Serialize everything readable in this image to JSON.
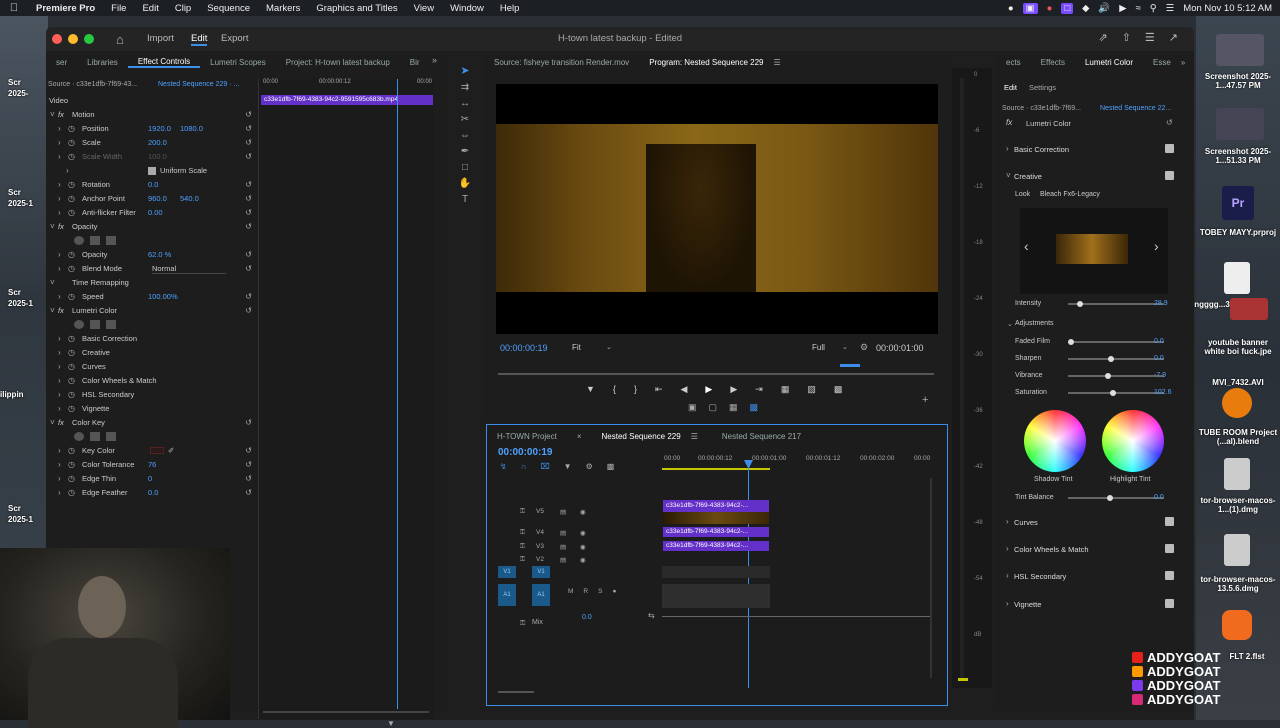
{
  "menubar": {
    "app": "Premiere Pro",
    "items": [
      "File",
      "Edit",
      "Clip",
      "Sequence",
      "Markers",
      "Graphics and Titles",
      "View",
      "Window",
      "Help"
    ],
    "clock": "Mon Nov 10  5:12 AM"
  },
  "window": {
    "title": "H-town latest backup",
    "edited": "- Edited",
    "workspaces": [
      "Import",
      "Edit",
      "Export"
    ],
    "active_workspace": "Edit"
  },
  "left_panel": {
    "tabs": [
      "ser",
      "Libraries",
      "Effect Controls",
      "Lumetri Scopes",
      "Project: H-town latest backup",
      "Bir"
    ],
    "source": "Source · c33e1dfb-7f69-43...",
    "sequence": "Nested Sequence 229 · ...",
    "timecodes": [
      "00:00",
      "00:00:00:12",
      "00:00"
    ],
    "clip_name": "c33e1dfb-7f69-4383-94c2-9591595c683b.mp4",
    "video_label": "Video",
    "rows": [
      {
        "label": "Motion",
        "indent": 1,
        "fx": true
      },
      {
        "label": "Position",
        "indent": 2,
        "v1": "1920.0",
        "v2": "1080.0"
      },
      {
        "label": "Scale",
        "indent": 2,
        "v1": "200.0"
      },
      {
        "label": "Scale Width",
        "indent": 2,
        "v1": "100.0",
        "dim": true
      },
      {
        "label": "Uniform Scale",
        "indent": 3,
        "check": true
      },
      {
        "label": "Rotation",
        "indent": 2,
        "v1": "0.0"
      },
      {
        "label": "Anchor Point",
        "indent": 2,
        "v1": "960.0",
        "v2": "540.0"
      },
      {
        "label": "Anti-flicker Filter",
        "indent": 2,
        "v1": "0.00"
      },
      {
        "label": "Opacity",
        "indent": 1,
        "fx": true
      },
      {
        "label": "",
        "indent": 2,
        "masks": true
      },
      {
        "label": "Opacity",
        "indent": 2,
        "v1": "62.0 %"
      },
      {
        "label": "Blend Mode",
        "indent": 2,
        "dropdown": "Normal"
      },
      {
        "label": "Time Remapping",
        "indent": 1
      },
      {
        "label": "Speed",
        "indent": 2,
        "v1": "100.00%"
      },
      {
        "label": "Lumetri Color",
        "indent": 1,
        "fx": true
      },
      {
        "label": "",
        "indent": 2,
        "masks": true
      },
      {
        "label": "Basic Correction",
        "indent": 2
      },
      {
        "label": "Creative",
        "indent": 2
      },
      {
        "label": "Curves",
        "indent": 2
      },
      {
        "label": "Color Wheels & Match",
        "indent": 2
      },
      {
        "label": "HSL Secondary",
        "indent": 2
      },
      {
        "label": "Vignette",
        "indent": 2
      },
      {
        "label": "Color Key",
        "indent": 1,
        "fx": true
      },
      {
        "label": "",
        "indent": 2,
        "masks": true
      },
      {
        "label": "Key Color",
        "indent": 2,
        "swatch": true
      },
      {
        "label": "Color Tolerance",
        "indent": 2,
        "v1": "76"
      },
      {
        "label": "Edge Thin",
        "indent": 2,
        "v1": "0"
      },
      {
        "label": "Edge Feather",
        "indent": 2,
        "v1": "0.0"
      }
    ]
  },
  "program": {
    "source_tab": "Source: fisheye transition Render.mov",
    "program_tab": "Program: Nested Sequence 229",
    "timecode": "00:00:00:19",
    "fit": "Fit",
    "quality": "Full",
    "duration": "00:00:01:00"
  },
  "timeline": {
    "tabs": [
      "H-TOWN Project",
      "Nested Sequence 229",
      "Nested Sequence 217"
    ],
    "active_tab": "Nested Sequence 229",
    "timecode": "00:00:00:19",
    "ruler": [
      "00:00",
      "00:00:00:12",
      "00:00:01:00",
      "00:00:01:12",
      "00:00:02:00",
      "00:00"
    ],
    "tracks": [
      "V5",
      "V4",
      "V3",
      "V2",
      "V1",
      "A1"
    ],
    "clip": "c33e1dfb-7f69-4383-94c2-...",
    "mix_label": "Mix",
    "mix_value": "0.0",
    "audio_buttons": [
      "M",
      "R",
      "S"
    ],
    "source_patch": [
      "V1",
      "A1"
    ]
  },
  "meter_scale": [
    "0",
    "-6",
    "-12",
    "-18",
    "-24",
    "-30",
    "-36",
    "-42",
    "-48",
    "-54",
    "dB"
  ],
  "lumetri": {
    "tabs": [
      "ects",
      "Effects",
      "Lumetri Color",
      "Esse"
    ],
    "subtabs": [
      "Edit",
      "Settings"
    ],
    "source": "Source · c33e1dfb-7f69...",
    "sequence": "Nested Sequence 22...",
    "effect": "Lumetri Color",
    "sections": [
      "Basic Correction",
      "Creative",
      "Curves",
      "Color Wheels & Match",
      "HSL Secondary",
      "Vignette"
    ],
    "look_label": "Look",
    "look_value": "Bleach Fx6-Legacy",
    "intensity_label": "Intensity",
    "intensity_value": "28.9",
    "adjustments_label": "Adjustments",
    "adjustments": [
      {
        "label": "Faded Film",
        "value": "0.0"
      },
      {
        "label": "Sharpen",
        "value": "0.0"
      },
      {
        "label": "Vibrance",
        "value": "-7.9"
      },
      {
        "label": "Saturation",
        "value": "102.6"
      }
    ],
    "shadow_tint": "Shadow Tint",
    "highlight_tint": "Highlight Tint",
    "tint_balance_label": "Tint Balance",
    "tint_balance_value": "0.0"
  },
  "desktop": {
    "left_labels": [
      "Scr",
      "2025-",
      "Scr",
      "2025-1",
      "Scr",
      "2025-1",
      "ilippin",
      "Scr",
      "2025-1"
    ],
    "right_items": [
      {
        "label": "Screenshot 2025-1...47.57 PM"
      },
      {
        "label": "Screenshot 2025-1...51.33 PM"
      },
      {
        "label": "TOBEY MAYY.prproj"
      },
      {
        "label": "pngggg...3.png"
      },
      {
        "label": "youtube banner white boi fuck.jpe"
      },
      {
        "label": "MVI_7432.AVI"
      },
      {
        "label": "TUBE ROOM Project (...al).blend"
      },
      {
        "label": "tor-browser-macos-1...(1).dmg"
      },
      {
        "label": "tor-browser-macos-13.5.6.dmg"
      },
      {
        "label": "FLT 2.flst"
      }
    ],
    "social": [
      "ADDYGOAT",
      "ADDYGOAT",
      "ADDYGOAT",
      "ADDYGOAT"
    ]
  },
  "colors": {
    "accent": "#3b8eea",
    "clip": "#6330c9",
    "timecode": "#4ea1ff"
  }
}
